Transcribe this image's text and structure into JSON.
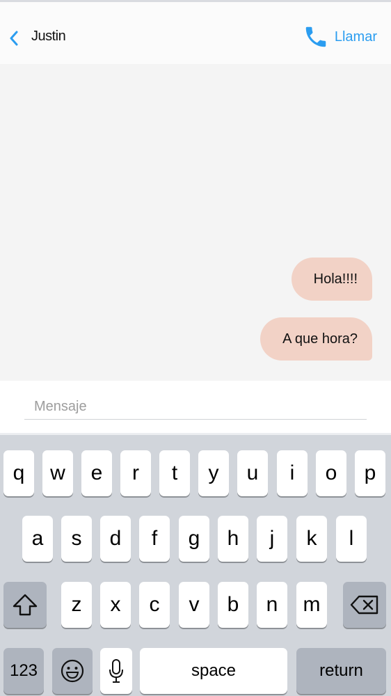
{
  "header": {
    "contact_name": "Justin",
    "call_label": "Llamar",
    "accent_color": "#2b9df0"
  },
  "messages": [
    {
      "text": "Hola!!!!"
    },
    {
      "text": "A que hora?"
    }
  ],
  "compose": {
    "placeholder": "Mensaje",
    "value": ""
  },
  "keyboard": {
    "row1": [
      "q",
      "w",
      "e",
      "r",
      "t",
      "y",
      "u",
      "i",
      "o",
      "p"
    ],
    "row2": [
      "a",
      "s",
      "d",
      "f",
      "g",
      "h",
      "j",
      "k",
      "l"
    ],
    "row3": [
      "z",
      "x",
      "c",
      "v",
      "b",
      "n",
      "m"
    ],
    "numbers_label": "123",
    "space_label": "space",
    "return_label": "return",
    "icons": [
      "shift-icon",
      "backspace-icon",
      "emoji-icon",
      "microphone-icon"
    ]
  }
}
